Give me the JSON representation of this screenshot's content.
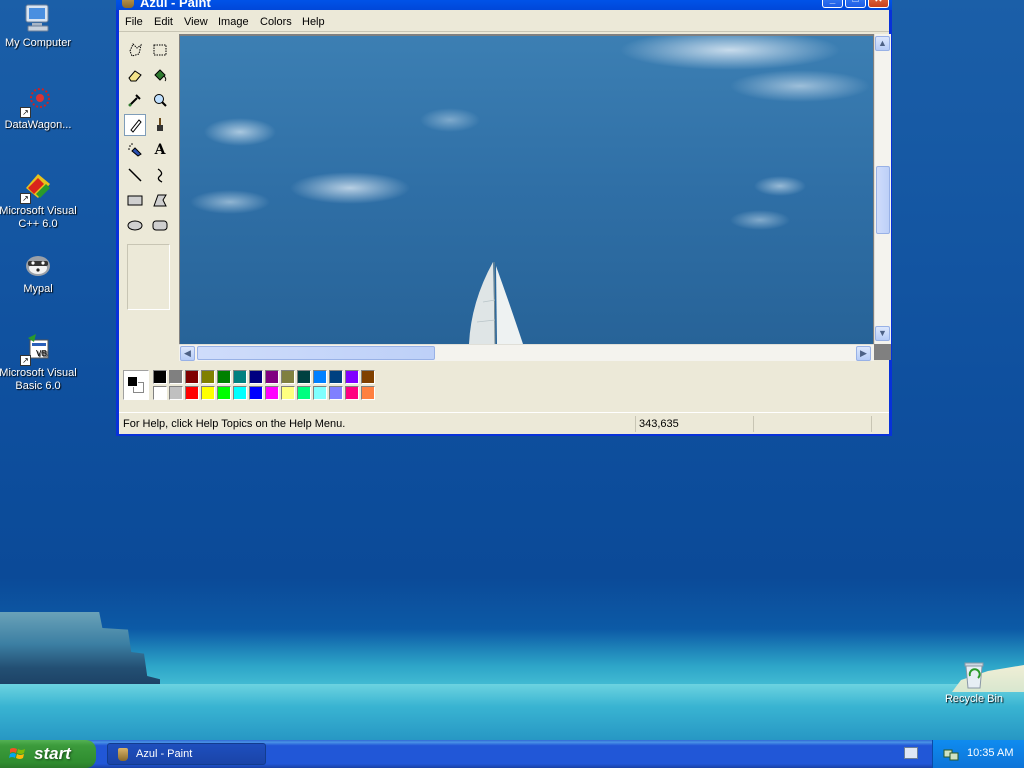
{
  "desktop": {
    "icons": [
      {
        "label": "My Computer",
        "icon": "my-computer-icon"
      },
      {
        "label": "DataWagon...",
        "icon": "datawagon-icon"
      },
      {
        "label": "Microsoft Visual C++ 6.0",
        "icon": "visual-cpp-icon"
      },
      {
        "label": "Mypal",
        "icon": "mypal-icon"
      },
      {
        "label": "Microsoft Visual Basic 6.0",
        "icon": "visual-basic-icon"
      },
      {
        "label": "Recycle Bin",
        "icon": "recycle-bin-icon"
      }
    ]
  },
  "window": {
    "title": "Azul - Paint",
    "menu": [
      "File",
      "Edit",
      "View",
      "Image",
      "Colors",
      "Help"
    ],
    "status": {
      "help_text": "For Help, click Help Topics on the Help Menu.",
      "coordinates": "343,635"
    },
    "tools": [
      "free-form-select-tool",
      "select-tool",
      "eraser-tool",
      "fill-tool",
      "pick-color-tool",
      "magnifier-tool",
      "pencil-tool",
      "brush-tool",
      "airbrush-tool",
      "text-tool",
      "line-tool",
      "curve-tool",
      "rectangle-tool",
      "polygon-tool",
      "ellipse-tool",
      "rounded-rectangle-tool"
    ],
    "active_tool": "pencil-tool",
    "palette_top": [
      "#000000",
      "#808080",
      "#800000",
      "#808000",
      "#008000",
      "#008080",
      "#000080",
      "#800080",
      "#808040",
      "#004040",
      "#0080ff",
      "#004080",
      "#8000ff",
      "#804000"
    ],
    "palette_bottom": [
      "#ffffff",
      "#c0c0c0",
      "#ff0000",
      "#ffff00",
      "#00ff00",
      "#00ffff",
      "#0000ff",
      "#ff00ff",
      "#ffff80",
      "#00ff80",
      "#80ffff",
      "#8080ff",
      "#ff0080",
      "#ff8040"
    ],
    "foreground_color": "#000000",
    "background_color": "#ffffff"
  },
  "taskbar": {
    "start_label": "start",
    "task_label": "Azul - Paint",
    "clock": "10:35 AM"
  }
}
